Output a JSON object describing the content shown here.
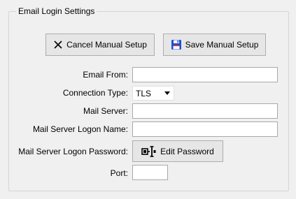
{
  "group": {
    "title": "Email Login Settings"
  },
  "buttons": {
    "cancel_label": "Cancel Manual Setup",
    "save_label": "Save Manual Setup",
    "edit_password_label": "Edit Password"
  },
  "icons": {
    "cancel": "close-x-icon",
    "save": "floppy-disk-icon",
    "edit_password": "password-field-cursor-icon",
    "save_color": "#1a4fd6",
    "save_accent_color": "#e0302e"
  },
  "form": {
    "email_from": {
      "label": "Email From:",
      "value": ""
    },
    "connection_type": {
      "label": "Connection Type:",
      "value": "TLS"
    },
    "mail_server": {
      "label": "Mail Server:",
      "value": ""
    },
    "logon_name": {
      "label": "Mail Server Logon Name:",
      "value": ""
    },
    "logon_password": {
      "label": "Mail Server Logon Password:"
    },
    "port": {
      "label": "Port:",
      "value": ""
    }
  }
}
